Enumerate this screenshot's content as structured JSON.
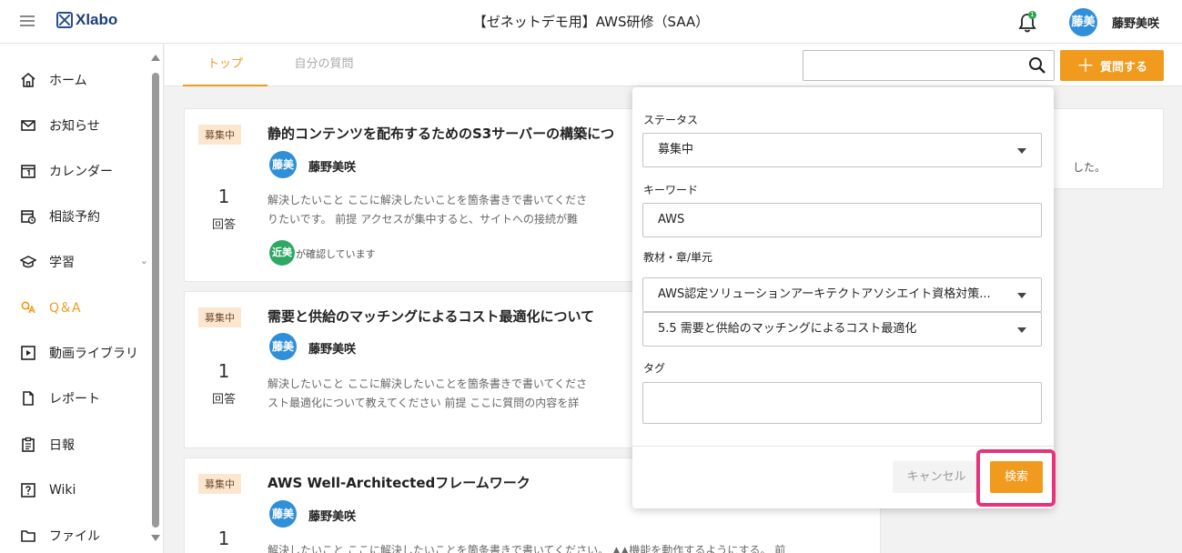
{
  "header": {
    "logo": "Xlabo",
    "title": "【ゼネットデモ用】AWS研修（SAA）",
    "notification_count": "1",
    "user_avatar": "藤美",
    "user_name": "藤野美咲"
  },
  "sidebar": {
    "items": [
      {
        "label": "ホーム",
        "icon": "home-icon"
      },
      {
        "label": "お知らせ",
        "icon": "mail-icon"
      },
      {
        "label": "カレンダー",
        "icon": "calendar-icon"
      },
      {
        "label": "相談予約",
        "icon": "calendar-clock-icon"
      },
      {
        "label": "学習",
        "icon": "graduation-cap-icon"
      },
      {
        "label": "Q＆A",
        "icon": "qa-icon"
      },
      {
        "label": "動画ライブラリ",
        "icon": "video-icon"
      },
      {
        "label": "レポート",
        "icon": "document-icon"
      },
      {
        "label": "日報",
        "icon": "clipboard-icon"
      },
      {
        "label": "Wiki",
        "icon": "wiki-icon"
      },
      {
        "label": "ファイル",
        "icon": "folder-icon"
      }
    ],
    "active": "Q＆A"
  },
  "tabs": {
    "top": "トップ",
    "mine": "自分の質問"
  },
  "search": {
    "placeholder": ""
  },
  "ask_button": {
    "plus": "＋",
    "label": "質問する"
  },
  "questions": [
    {
      "status": "募集中",
      "title": "静的コンテンツを配布するためのS3サーバーの構築につ",
      "author_avatar": "藤美",
      "author": "藤野美咲",
      "answers": "1",
      "answers_label": "回答",
      "excerpt_line1": "解決したいこと ここに解決したいことを箇条書きで書いてくださ",
      "excerpt_line2": "りたいです。 前提 アクセスが集中すると、サイトへの接続が難",
      "checker_avatar": "近美",
      "checker_text": "が確認しています"
    },
    {
      "status": "募集中",
      "title": "需要と供給のマッチングによるコスト最適化について",
      "author_avatar": "藤美",
      "author": "藤野美咲",
      "answers": "1",
      "answers_label": "回答",
      "excerpt_line1": "解決したいこと ここに解決したいことを箇条書きで書いてくださ",
      "excerpt_line2": "スト最適化について教えてください 前提 ここに質問の内容を詳"
    },
    {
      "status": "募集中",
      "title": "AWS Well-Architectedフレームワーク",
      "author_avatar": "藤美",
      "author": "藤野美咲",
      "answers": "1",
      "excerpt_line1": "解決したいこと ここに解決したいことを箇条書きで書いてください。 ▲▲機能を動作するようにする。 前"
    }
  ],
  "side_info": {
    "text": "した。"
  },
  "filter": {
    "status_label": "ステータス",
    "status_value": "募集中",
    "keyword_label": "キーワード",
    "keyword_value": "AWS",
    "material_label": "教材・章/単元",
    "material_value": "AWS認定ソリューションアーキテクトアソシエイト資格対策...",
    "chapter_value": "5.5 需要と供給のマッチングによるコスト最適化",
    "tag_label": "タグ",
    "tag_value": "",
    "cancel_label": "キャンセル",
    "submit_label": "検索",
    "highlight_color": "#e8337a"
  },
  "colors": {
    "accent": "#f09a1e",
    "avatar_blue": "#2f8fd8",
    "avatar_green": "#2fa864",
    "badge_bg": "#fde6d0"
  }
}
